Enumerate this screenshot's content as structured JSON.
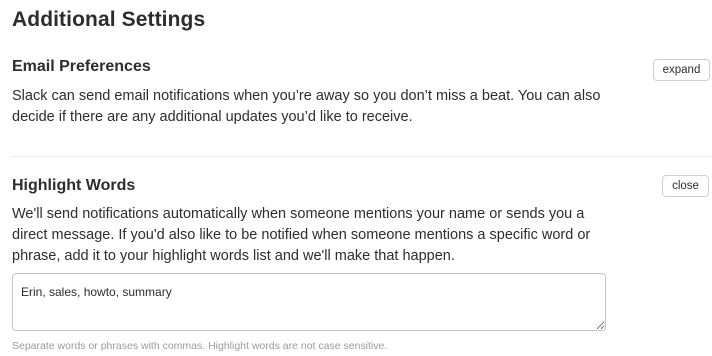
{
  "page": {
    "title": "Additional Settings"
  },
  "email_preferences": {
    "title": "Email Preferences",
    "description": "Slack can send email notifications when you’re away so you don’t miss a beat. You can also decide if there are any additional updates you’d like to receive.",
    "button_label": "expand"
  },
  "highlight_words": {
    "title": "Highlight Words",
    "description": "We'll send notifications automatically when someone mentions your name or sends you a direct message. If you'd also like to be notified when someone mentions a specific word or phrase, add it to your highlight words list and we'll make that happen.",
    "button_label": "close",
    "input_value": "Erin, sales, howto, summary",
    "hint": "Separate words or phrases with commas. Highlight words are not case sensitive."
  }
}
